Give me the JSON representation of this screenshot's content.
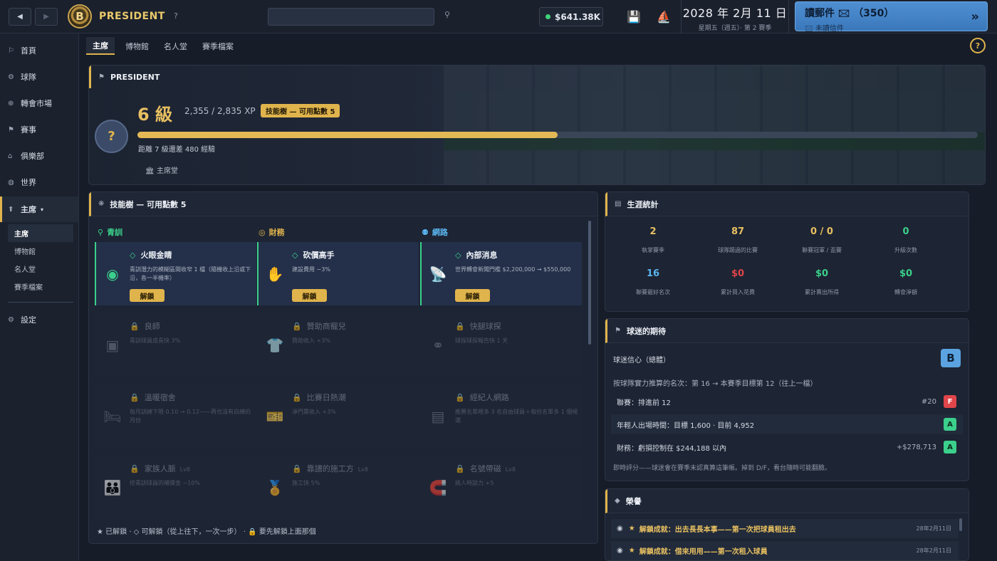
{
  "topbar": {
    "back": "◀",
    "forward": "▶",
    "logo": "B",
    "brand": "PRESIDENT",
    "help": "?",
    "cash": "$641.38K",
    "date_main": "2028 年 2月 11 日",
    "date_sub": "星期五（週五）· 第 2 賽季",
    "mail_title": "讀郵件 🖂 （350）",
    "mail_sub": "🖂 未讀信件",
    "mail_arrow": "»"
  },
  "sidebar": {
    "items": [
      {
        "icon": "⚐",
        "label": "首頁"
      },
      {
        "icon": "⚙",
        "label": "球隊"
      },
      {
        "icon": "⊕",
        "label": "轉會市場"
      },
      {
        "icon": "⚑",
        "label": "賽事"
      },
      {
        "icon": "⌂",
        "label": "俱樂部"
      },
      {
        "icon": "◍",
        "label": "世界"
      },
      {
        "icon": "⬆",
        "label": "主席",
        "caret": "▾"
      },
      {
        "icon": "⚙",
        "label": "設定"
      }
    ],
    "sub_items": [
      "主席",
      "博物館",
      "名人堂",
      "賽季檔案"
    ]
  },
  "tabs": [
    "主席",
    "博物館",
    "名人堂",
    "賽季檔案"
  ],
  "help_circle": "?",
  "president": {
    "header": "PRESIDENT",
    "avatar": "?",
    "level": "6 級",
    "xp": "2,355 / 2,835 XP",
    "skill_badge": "技能樹 — 可用點數 5",
    "xp_progress": 0.5,
    "next_level": "距離 7 級還差 480 經驗",
    "hall": "🏛 主席堂"
  },
  "skill_tree": {
    "header": "技能樹 — 可用點數 5",
    "columns": [
      {
        "icon": "⚲",
        "name": "青訓",
        "color": "#3bd08b"
      },
      {
        "icon": "◎",
        "name": "財務",
        "color": "#e0b44c"
      },
      {
        "icon": "⚉",
        "name": "網路",
        "color": "#5ab6f0"
      }
    ],
    "unlock_label": "解鎖",
    "skills": [
      {
        "title": "火眼金睛",
        "desc": "青訓潛力的模糊區間收窄 1 檔（隨機收上沿或下沿，各一半機率）",
        "icon": "◉",
        "state": "unlockable",
        "lv": ""
      },
      {
        "title": "砍價高手",
        "desc": "建設費用 −3%",
        "icon": "✋",
        "state": "unlockable",
        "lv": ""
      },
      {
        "title": "內部消息",
        "desc": "世界轉會新聞門檻 $2,200,000 → $550,000",
        "icon": "📡",
        "state": "unlockable",
        "lv": ""
      },
      {
        "title": "良師",
        "desc": "青訓球員成長快 3%",
        "icon": "▣",
        "state": "locked",
        "lv": ""
      },
      {
        "title": "贊助商寵兒",
        "desc": "贊助收入 +3%",
        "icon": "👕",
        "state": "locked",
        "lv": ""
      },
      {
        "title": "快腿球探",
        "desc": "球探球探報告快 1 天",
        "icon": "⚭",
        "state": "locked",
        "lv": ""
      },
      {
        "title": "溫暖宿舍",
        "desc": "每月訓練下限 0.10 → 0.12——再也沒有白練的月份",
        "icon": "🛏",
        "state": "locked",
        "lv": ""
      },
      {
        "title": "比賽日熱潮",
        "desc": "淨門票收入 +3%",
        "icon": "🎫",
        "state": "locked",
        "lv": ""
      },
      {
        "title": "經紀人網路",
        "desc": "推薦名單裡多 3 名自由球員＋每份名單多 1 個候選",
        "icon": "▤",
        "state": "locked",
        "lv": ""
      },
      {
        "title": "家族人脈",
        "desc": "挖青訓球員的補償金 −10%",
        "icon": "👪",
        "state": "locked",
        "lv": "Lv8"
      },
      {
        "title": "靠譜的施工方",
        "desc": "施工快 5%",
        "icon": "🏅",
        "state": "locked",
        "lv": "Lv8"
      },
      {
        "title": "名號帶磁",
        "desc": "挑人時談力 +5",
        "icon": "🧲",
        "state": "locked",
        "lv": "Lv8"
      }
    ],
    "legend": "★ 已解鎖 · ◇ 可解鎖（從上往下，一次一步） · 🔒 要先解鎖上面那個"
  },
  "career": {
    "header": "生涯統計",
    "stats": [
      {
        "value": "2",
        "label": "執掌賽季",
        "color": "#e8c061"
      },
      {
        "value": "87",
        "label": "球隊踢過的比賽",
        "color": "#e8c061"
      },
      {
        "value": "0 / 0",
        "label": "聯賽冠軍 / 盃賽",
        "color": "#e8c061"
      },
      {
        "value": "0",
        "label": "升級次數",
        "color": "#3bd08b"
      },
      {
        "value": "16",
        "label": "聯賽最好名次",
        "color": "#5ab6f0"
      },
      {
        "value": "$0",
        "label": "累計買入花費",
        "color": "#e0454a"
      },
      {
        "value": "$0",
        "label": "累計賣出所得",
        "color": "#3bd08b"
      },
      {
        "value": "$0",
        "label": "轉會淨額",
        "color": "#3bd08b"
      }
    ]
  },
  "fans": {
    "header": "球迷的期待",
    "confidence_label": "球迷信心（總體）",
    "confidence_grade": "B",
    "predicted": "按球隊實力推算的名次：第 16 → 本賽季目標第 12（往上一檔）",
    "rows": [
      {
        "label": "聯賽：排進前 12",
        "value": "#20",
        "grade": "F"
      },
      {
        "label": "年輕人出場時間：目標 1,600 · 目前 4,952",
        "value": "",
        "grade": "A"
      },
      {
        "label": "財務：虧損控制在 $244,188 以內",
        "value": "+$278,713",
        "grade": "A"
      }
    ],
    "note": "即時評分——球迷會在賽季末認真算這筆帳。掉到 D/F，看台隨時可能翻臉。"
  },
  "honors": {
    "header": "榮譽",
    "rows": [
      {
        "text": "解鎖成就：出去長長本事——第一次把球員租出去",
        "date": "28年2月11日"
      },
      {
        "text": "解鎖成就：借來用用——第一次租入球員",
        "date": "28年2月11日"
      }
    ]
  },
  "colors": {
    "accent": "#e0b44c",
    "green": "#3bd08b",
    "red": "#e0454a",
    "blue": "#5ab6f0"
  }
}
